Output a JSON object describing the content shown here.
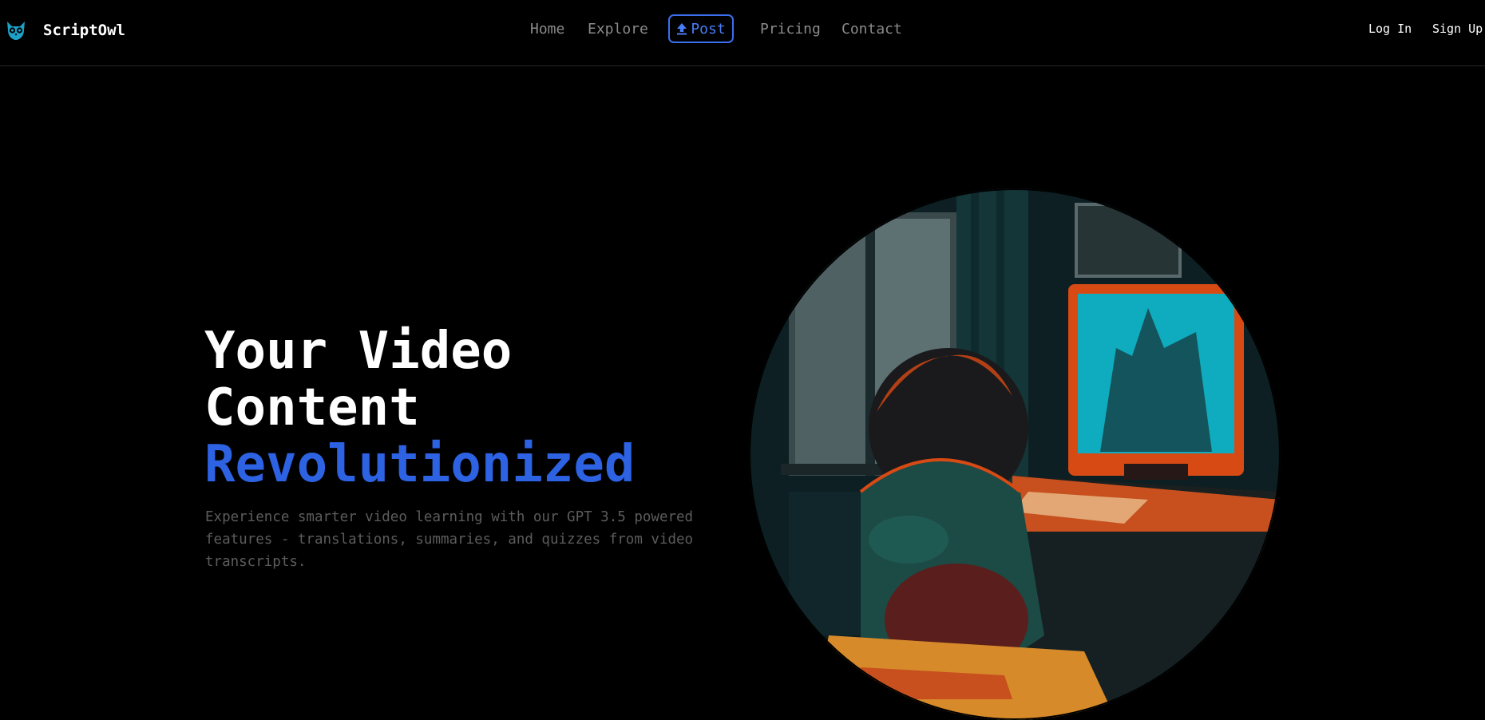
{
  "brand": {
    "name": "ScriptOwl",
    "logo_icon": "owl-icon",
    "logo_color": "#1da1c7"
  },
  "nav": {
    "home": "Home",
    "explore": "Explore",
    "post": "Post",
    "post_icon": "upload-icon",
    "pricing": "Pricing",
    "contact": "Contact"
  },
  "auth": {
    "login": "Log In",
    "signup": "Sign Up"
  },
  "hero": {
    "title_line1": "Your Video",
    "title_line2": "Content",
    "title_accent": "Revolutionized",
    "subtitle": "Experience smarter video learning with our GPT 3.5 powered features - translations, summaries, and quizzes from video transcripts."
  },
  "colors": {
    "background": "#000000",
    "accent": "#2d62e3",
    "nav_text": "#8a8a8a",
    "subtitle_text": "#5c5c5c"
  }
}
